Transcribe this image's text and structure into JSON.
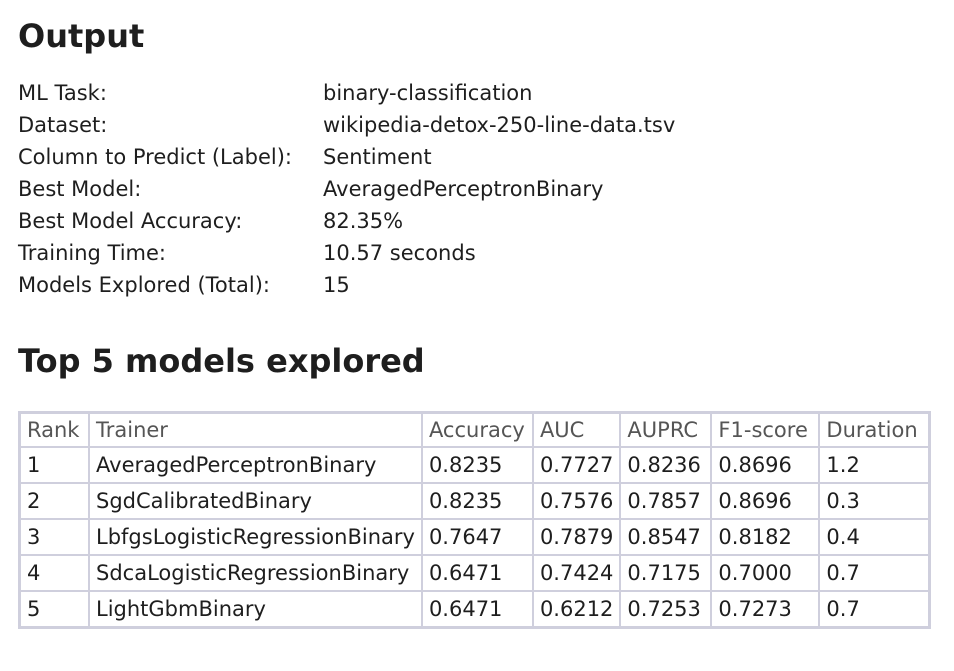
{
  "output": {
    "title": "Output",
    "rows": [
      {
        "label": "ML Task:",
        "value": "binary-classification"
      },
      {
        "label": "Dataset:",
        "value": "wikipedia-detox-250-line-data.tsv"
      },
      {
        "label": "Column to Predict (Label):",
        "value": "Sentiment"
      },
      {
        "label": "Best Model:",
        "value": "AveragedPerceptronBinary"
      },
      {
        "label": "Best Model Accuracy:",
        "value": "82.35%"
      },
      {
        "label": "Training Time:",
        "value": "10.57 seconds"
      },
      {
        "label": "Models Explored (Total):",
        "value": "15"
      }
    ]
  },
  "top_models": {
    "title": "Top 5 models explored",
    "headers": [
      "Rank",
      "Trainer",
      "Accuracy",
      "AUC",
      "AUPRC",
      "F1-score",
      "Duration"
    ],
    "rows": [
      [
        "1",
        "AveragedPerceptronBinary",
        "0.8235",
        "0.7727",
        "0.8236",
        "0.8696",
        "1.2"
      ],
      [
        "2",
        "SgdCalibratedBinary",
        "0.8235",
        "0.7576",
        "0.7857",
        "0.8696",
        "0.3"
      ],
      [
        "3",
        "LbfgsLogisticRegressionBinary",
        "0.7647",
        "0.7879",
        "0.8547",
        "0.8182",
        "0.4"
      ],
      [
        "4",
        "SdcaLogisticRegressionBinary",
        "0.6471",
        "0.7424",
        "0.7175",
        "0.7000",
        "0.7"
      ],
      [
        "5",
        "LightGbmBinary",
        "0.6471",
        "0.6212",
        "0.7253",
        "0.7273",
        "0.7"
      ]
    ]
  }
}
